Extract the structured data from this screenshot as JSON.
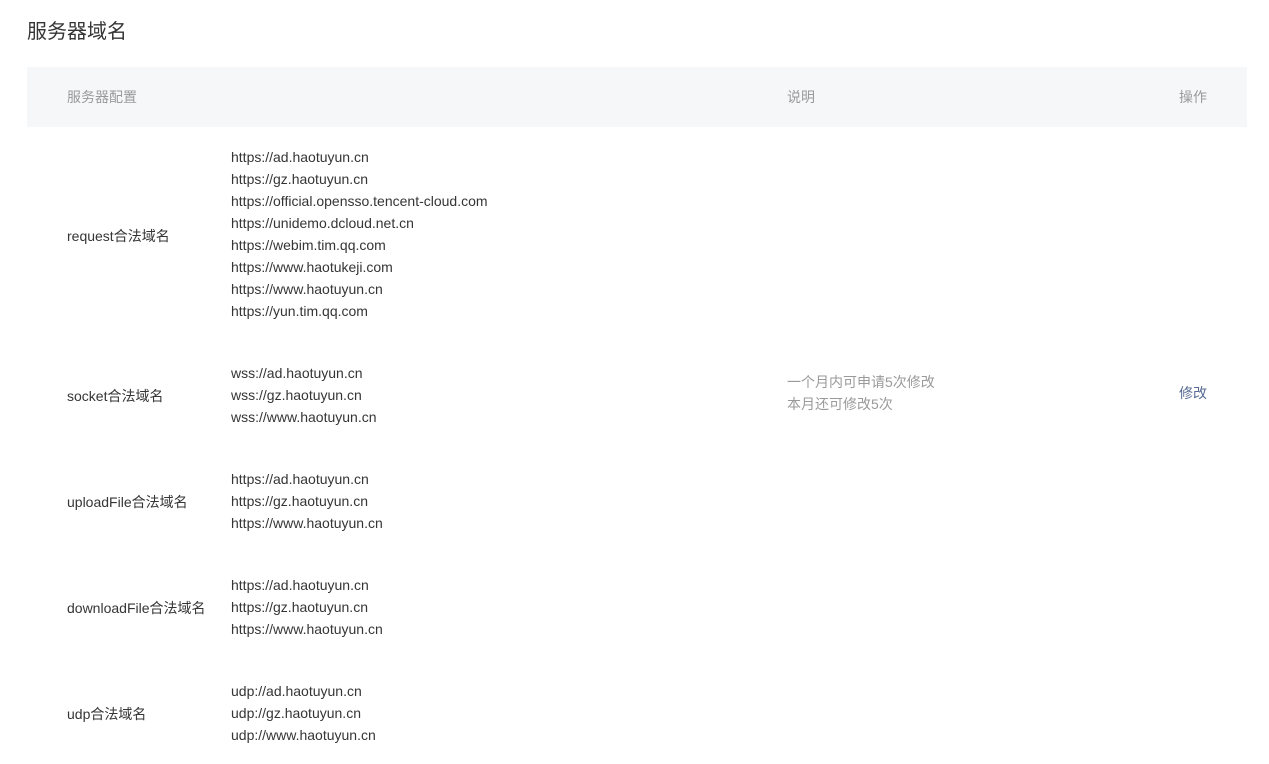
{
  "page": {
    "title": "服务器域名"
  },
  "table": {
    "headers": {
      "config": "服务器配置",
      "description": "说明",
      "action": "操作"
    },
    "rows": [
      {
        "label": "request合法域名",
        "domains": [
          "https://ad.haotuyun.cn",
          "https://gz.haotuyun.cn",
          "https://official.opensso.tencent-cloud.com",
          "https://unidemo.dcloud.net.cn",
          "https://webim.tim.qq.com",
          "https://www.haotukeji.com",
          "https://www.haotuyun.cn",
          "https://yun.tim.qq.com"
        ]
      },
      {
        "label": "socket合法域名",
        "domains": [
          "wss://ad.haotuyun.cn",
          "wss://gz.haotuyun.cn",
          "wss://www.haotuyun.cn"
        ]
      },
      {
        "label": "uploadFile合法域名",
        "domains": [
          "https://ad.haotuyun.cn",
          "https://gz.haotuyun.cn",
          "https://www.haotuyun.cn"
        ]
      },
      {
        "label": "downloadFile合法域名",
        "domains": [
          "https://ad.haotuyun.cn",
          "https://gz.haotuyun.cn",
          "https://www.haotuyun.cn"
        ]
      },
      {
        "label": "udp合法域名",
        "domains": [
          "udp://ad.haotuyun.cn",
          "udp://gz.haotuyun.cn",
          "udp://www.haotuyun.cn"
        ]
      }
    ],
    "description": {
      "line1": "一个月内可申请5次修改",
      "line2": "本月还可修改5次"
    },
    "action_label": "修改"
  },
  "colors": {
    "header_bg": "#f6f7f9",
    "text": "#353535",
    "muted": "#9a9a9a",
    "link": "#576b95"
  }
}
